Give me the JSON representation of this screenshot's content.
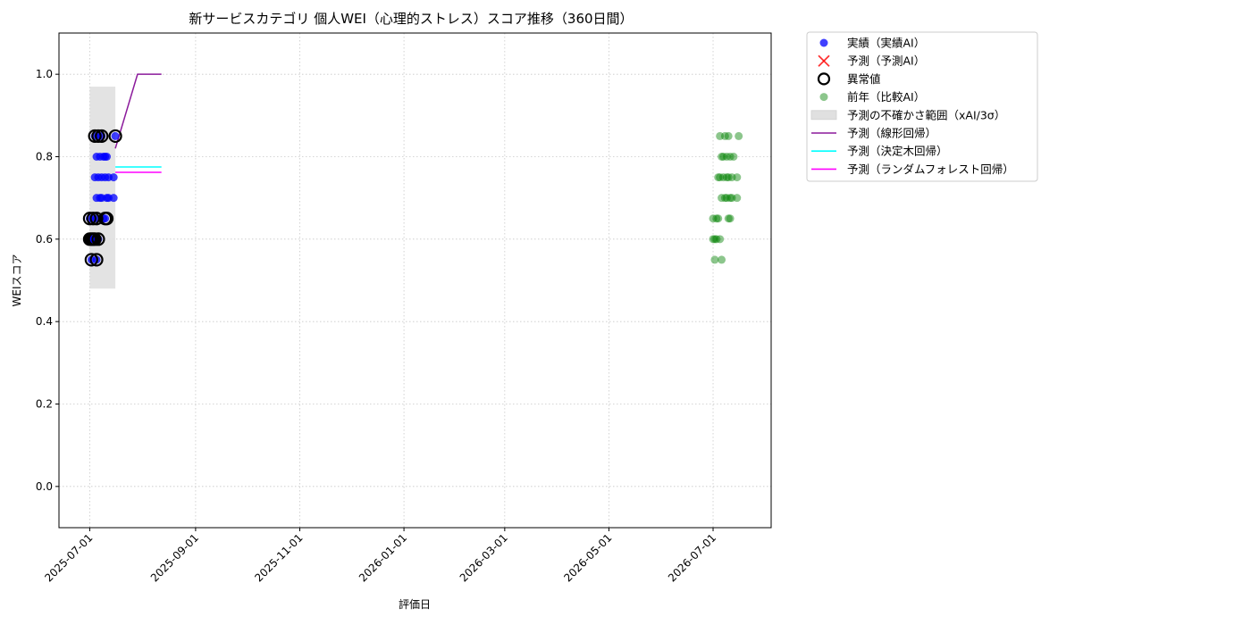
{
  "chart_data": {
    "type": "scatter",
    "title": "新サービスカテゴリ 個人WEI（心理的ストレス）スコア推移（360日間）",
    "xlabel": "評価日",
    "ylabel": "WEIスコア",
    "xlim": [
      "2025-06-13",
      "2026-08-04"
    ],
    "ylim": [
      -0.1,
      1.1
    ],
    "x_ticks": [
      "2025-07-01",
      "2025-09-01",
      "2025-11-01",
      "2026-01-01",
      "2026-03-01",
      "2026-05-01",
      "2026-07-01"
    ],
    "y_ticks": [
      0.0,
      0.2,
      0.4,
      0.6,
      0.8,
      1.0
    ],
    "y_tick_labels": [
      "0.0",
      "0.2",
      "0.4",
      "0.6",
      "0.8",
      "1.0"
    ],
    "grid": true,
    "legend_position": "outside-upper-right",
    "series": [
      {
        "name": "実績（実績AI）",
        "kind": "scatter",
        "color": "#0000ff",
        "points": [
          [
            "2025-07-01",
            0.65
          ],
          [
            "2025-07-01",
            0.6
          ],
          [
            "2025-07-02",
            0.55
          ],
          [
            "2025-07-02",
            0.6
          ],
          [
            "2025-07-03",
            0.65
          ],
          [
            "2025-07-03",
            0.6
          ],
          [
            "2025-07-04",
            0.85
          ],
          [
            "2025-07-04",
            0.6
          ],
          [
            "2025-07-04",
            0.75
          ],
          [
            "2025-07-05",
            0.8
          ],
          [
            "2025-07-05",
            0.55
          ],
          [
            "2025-07-05",
            0.7
          ],
          [
            "2025-07-05",
            0.65
          ],
          [
            "2025-07-06",
            0.85
          ],
          [
            "2025-07-06",
            0.6
          ],
          [
            "2025-07-06",
            0.75
          ],
          [
            "2025-07-07",
            0.8
          ],
          [
            "2025-07-07",
            0.7
          ],
          [
            "2025-07-08",
            0.85
          ],
          [
            "2025-07-08",
            0.75
          ],
          [
            "2025-07-08",
            0.7
          ],
          [
            "2025-07-09",
            0.8
          ],
          [
            "2025-07-09",
            0.65
          ],
          [
            "2025-07-10",
            0.75
          ],
          [
            "2025-07-10",
            0.8
          ],
          [
            "2025-07-10",
            0.65
          ],
          [
            "2025-07-11",
            0.7
          ],
          [
            "2025-07-11",
            0.8
          ],
          [
            "2025-07-12",
            0.75
          ],
          [
            "2025-07-12",
            0.7
          ],
          [
            "2025-07-15",
            0.75
          ],
          [
            "2025-07-15",
            0.7
          ],
          [
            "2025-07-16",
            0.85
          ]
        ]
      },
      {
        "name": "予測（予測AI）",
        "kind": "scatter",
        "color": "#ff0000",
        "points": []
      },
      {
        "name": "異常値",
        "kind": "outlier",
        "color": "#000000",
        "points": [
          [
            "2025-07-01",
            0.65
          ],
          [
            "2025-07-01",
            0.6
          ],
          [
            "2025-07-02",
            0.55
          ],
          [
            "2025-07-02",
            0.6
          ],
          [
            "2025-07-03",
            0.65
          ],
          [
            "2025-07-03",
            0.6
          ],
          [
            "2025-07-04",
            0.85
          ],
          [
            "2025-07-04",
            0.6
          ],
          [
            "2025-07-05",
            0.55
          ],
          [
            "2025-07-05",
            0.65
          ],
          [
            "2025-07-06",
            0.85
          ],
          [
            "2025-07-06",
            0.6
          ],
          [
            "2025-07-08",
            0.85
          ],
          [
            "2025-07-10",
            0.65
          ],
          [
            "2025-07-11",
            0.65
          ],
          [
            "2025-07-16",
            0.85
          ]
        ]
      },
      {
        "name": "前年（比較AI）",
        "kind": "scatter",
        "color": "#008000",
        "points": [
          [
            "2026-07-01",
            0.65
          ],
          [
            "2026-07-01",
            0.6
          ],
          [
            "2026-07-02",
            0.55
          ],
          [
            "2026-07-02",
            0.6
          ],
          [
            "2026-07-03",
            0.65
          ],
          [
            "2026-07-03",
            0.6
          ],
          [
            "2026-07-04",
            0.75
          ],
          [
            "2026-07-04",
            0.65
          ],
          [
            "2026-07-05",
            0.6
          ],
          [
            "2026-07-05",
            0.85
          ],
          [
            "2026-07-05",
            0.75
          ],
          [
            "2026-07-06",
            0.8
          ],
          [
            "2026-07-06",
            0.55
          ],
          [
            "2026-07-06",
            0.7
          ],
          [
            "2026-07-07",
            0.75
          ],
          [
            "2026-07-07",
            0.8
          ],
          [
            "2026-07-08",
            0.7
          ],
          [
            "2026-07-08",
            0.85
          ],
          [
            "2026-07-09",
            0.8
          ],
          [
            "2026-07-09",
            0.75
          ],
          [
            "2026-07-09",
            0.7
          ],
          [
            "2026-07-10",
            0.85
          ],
          [
            "2026-07-10",
            0.65
          ],
          [
            "2026-07-10",
            0.75
          ],
          [
            "2026-07-11",
            0.7
          ],
          [
            "2026-07-11",
            0.8
          ],
          [
            "2026-07-12",
            0.75
          ],
          [
            "2026-07-12",
            0.7
          ],
          [
            "2026-07-13",
            0.8
          ],
          [
            "2026-07-15",
            0.75
          ],
          [
            "2026-07-15",
            0.7
          ],
          [
            "2026-07-16",
            0.85
          ],
          [
            "2026-07-11",
            0.65
          ]
        ]
      },
      {
        "name": "予測の不確かさ範囲（xAI/3σ）",
        "kind": "band",
        "color": "#e0e0e0",
        "x_range": [
          "2025-07-01",
          "2025-07-16"
        ],
        "y_range": [
          0.48,
          0.97
        ]
      },
      {
        "name": "予測（線形回帰）",
        "kind": "line",
        "color": "#8b1a9b",
        "points": [
          [
            "2025-07-16",
            0.82
          ],
          [
            "2025-07-29",
            1.0
          ],
          [
            "2025-08-12",
            1.0
          ]
        ]
      },
      {
        "name": "予測（決定木回帰）",
        "kind": "line",
        "color": "#00ffff",
        "points": [
          [
            "2025-07-16",
            0.775
          ],
          [
            "2025-08-12",
            0.775
          ]
        ]
      },
      {
        "name": "予測（ランダムフォレスト回帰）",
        "kind": "line",
        "color": "#ff00ff",
        "points": [
          [
            "2025-07-16",
            0.762
          ],
          [
            "2025-08-12",
            0.762
          ]
        ]
      }
    ]
  }
}
